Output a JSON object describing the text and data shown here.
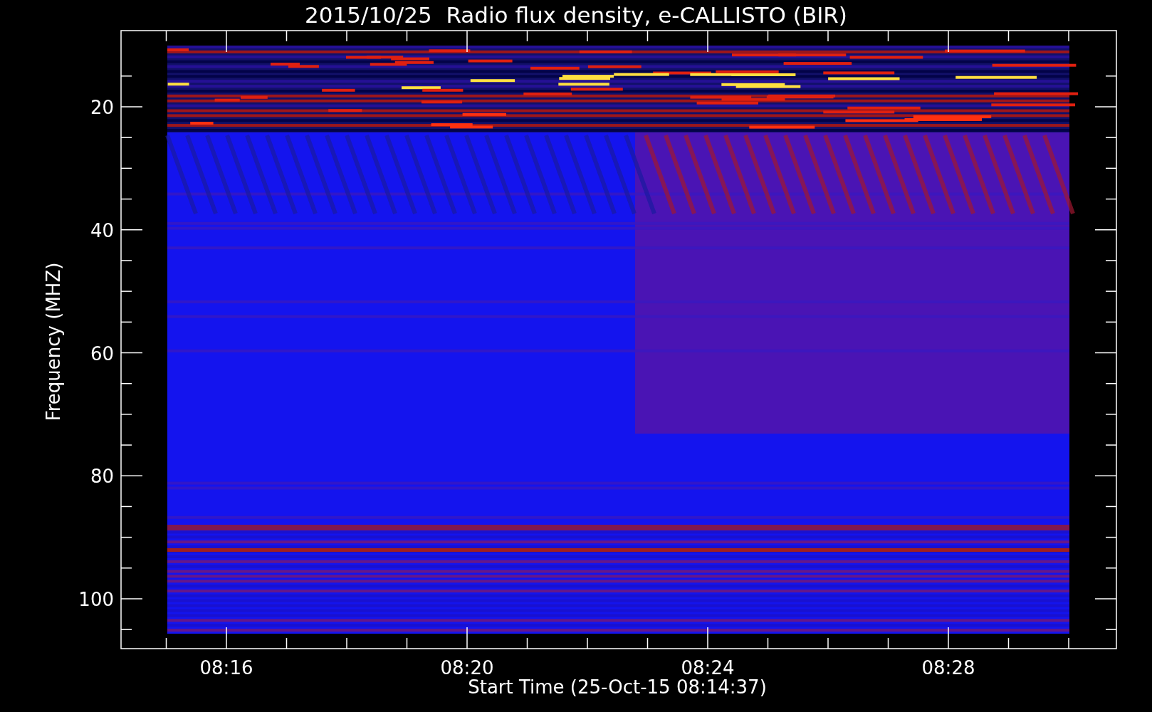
{
  "title": "2015/10/25  Radio flux density, e-CALLISTO (BIR)",
  "y_axis": {
    "label": "Frequency (MHZ)",
    "ticks": [
      "20",
      "40",
      "60",
      "80",
      "100"
    ]
  },
  "x_axis": {
    "label": "Start Time (25-Oct-15 08:14:37)",
    "ticks": [
      "08:16",
      "08:20",
      "08:24",
      "08:28"
    ]
  }
}
